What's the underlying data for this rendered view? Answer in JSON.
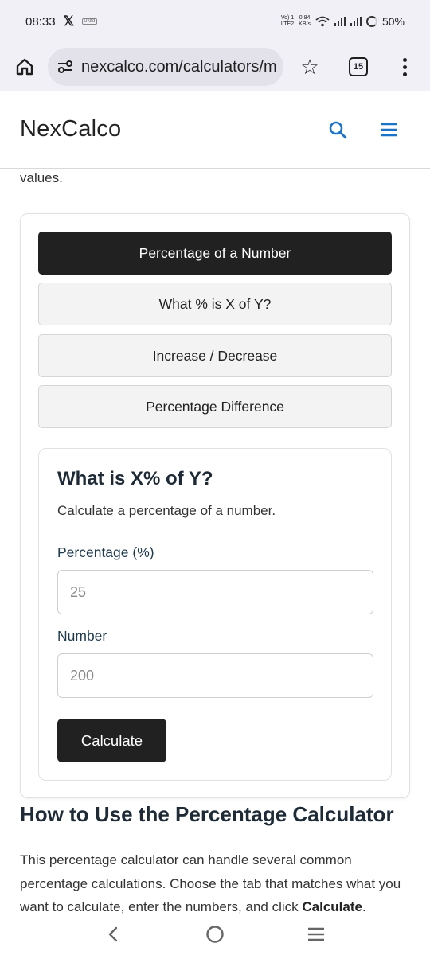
{
  "status_bar": {
    "time": "08:33",
    "x_glyph": "𝕏",
    "tiny_badge": "UNSI",
    "network_top": "Vo) 1",
    "network_bottom": "LTE2",
    "speed_top": "0.84",
    "speed_bottom": "KB/s",
    "battery": "50%"
  },
  "browser": {
    "url": "nexcalco.com/calculators/m",
    "tab_count": "15",
    "star_glyph": "☆"
  },
  "site": {
    "logo": "NexCalco"
  },
  "intro_tail": "values.",
  "tabs": [
    {
      "label": "Percentage of a Number",
      "active": true
    },
    {
      "label": "What % is X of Y?",
      "active": false
    },
    {
      "label": "Increase / Decrease",
      "active": false
    },
    {
      "label": "Percentage Difference",
      "active": false
    }
  ],
  "form": {
    "title": "What is X% of Y?",
    "subtitle": "Calculate a percentage of a number.",
    "percentage_label": "Percentage (%)",
    "percentage_placeholder": "25",
    "number_label": "Number",
    "number_placeholder": "200",
    "calculate_label": "Calculate"
  },
  "section": {
    "title": "How to Use the Percentage Calculator",
    "body_text": "This percentage calculator can handle several common percentage calculations. Choose the tab that matches what you want to calculate, enter the numbers, and click ",
    "body_bold": "Calculate",
    "body_end": "."
  },
  "colors": {
    "accent_blue": "#1a73c8",
    "dark_button": "#212121",
    "chrome_bg": "#f1f0f6"
  }
}
